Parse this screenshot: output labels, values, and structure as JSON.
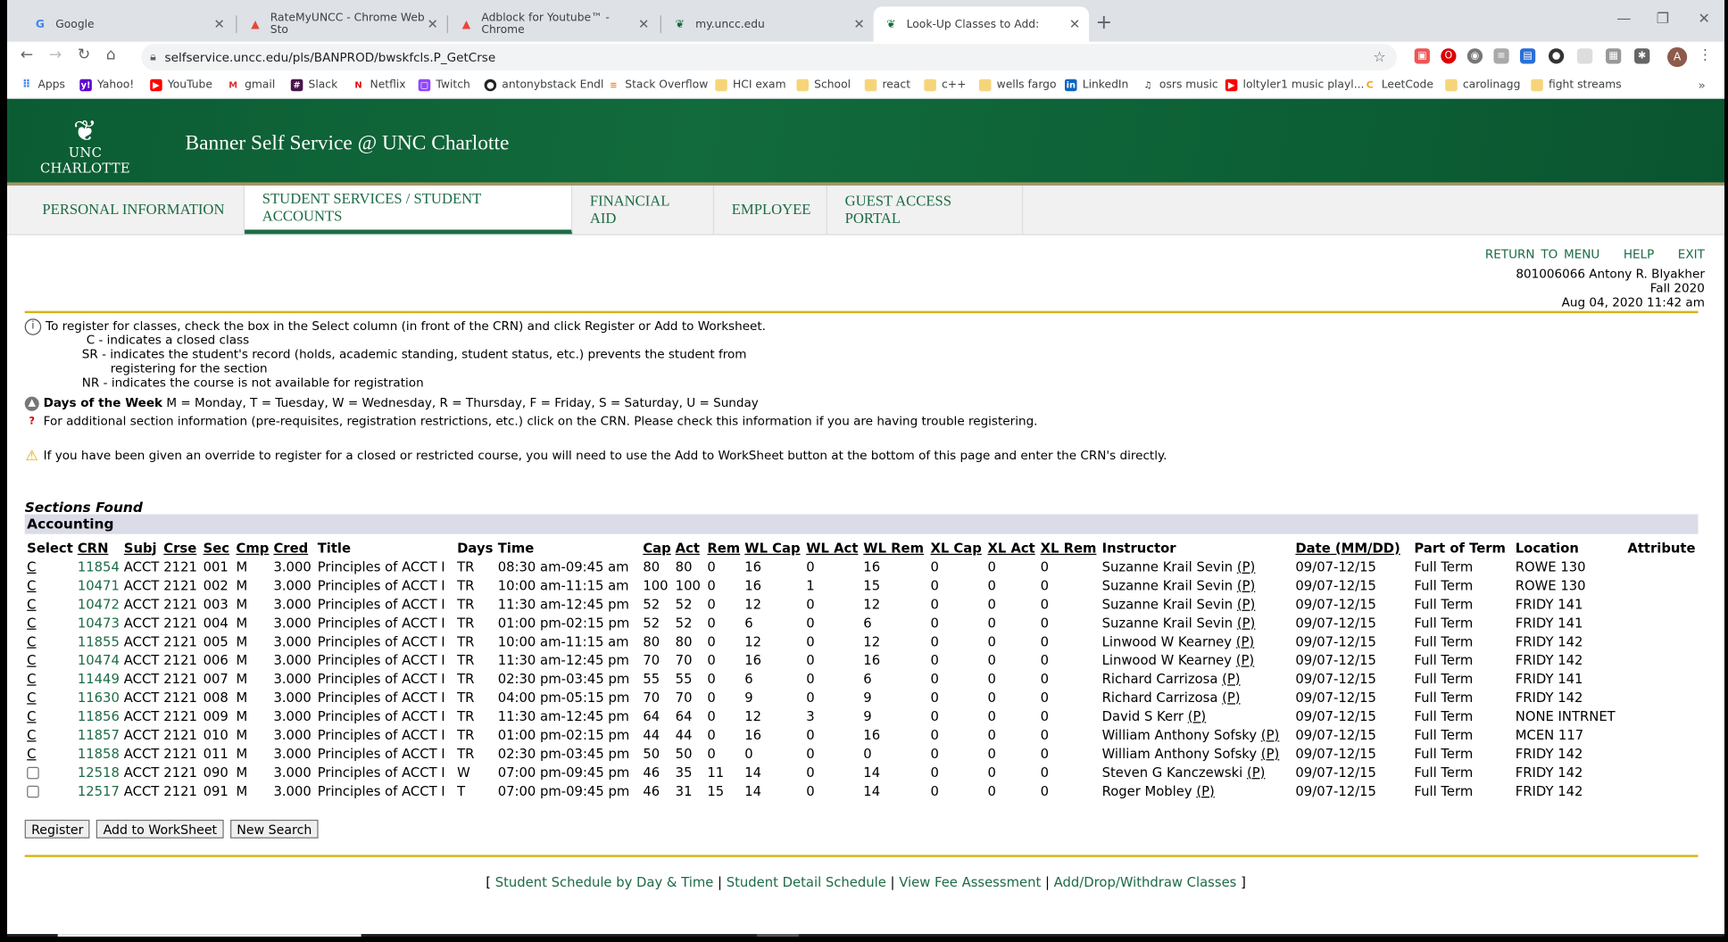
{
  "browser": {
    "tabs": [
      {
        "title": "Google",
        "favicon": "G"
      },
      {
        "title": "RateMyUNCC - Chrome Web Sto",
        "favicon": "▲"
      },
      {
        "title": "Adblock for Youtube™ - Chrome",
        "favicon": "▲"
      },
      {
        "title": "my.uncc.edu",
        "favicon": "❦"
      },
      {
        "title": "Look-Up Classes to Add:",
        "favicon": "❦"
      }
    ],
    "url": "selfservice.uncc.edu/pls/BANPROD/bwskfcls.P_GetCrse",
    "bookmarks": [
      "Apps",
      "Yahoo!",
      "YouTube",
      "gmail",
      "Slack",
      "Netflix",
      "Twitch",
      "antonybstack Endl",
      "Stack Overflow",
      "HCI exam",
      "School",
      "react",
      "c++",
      "wells fargo",
      "LinkedIn",
      "osrs music",
      "loltyler1 music playl...",
      "LeetCode",
      "carolinagg",
      "fight streams"
    ],
    "avatar_letter": "A"
  },
  "site": {
    "logo_text": "UNC CHARLOTTE",
    "title": "Banner Self Service @ UNC Charlotte",
    "nav": [
      "PERSONAL INFORMATION",
      "STUDENT SERVICES / STUDENT ACCOUNTS",
      "FINANCIAL AID",
      "EMPLOYEE",
      "GUEST ACCESS PORTAL"
    ],
    "toplinks": {
      "menu": "RETURN TO MENU",
      "help": "HELP",
      "exit": "EXIT"
    },
    "user": {
      "id_name": "801006066 Antony R. Blyakher",
      "term": "Fall 2020",
      "datetime": "Aug 04, 2020 11:42 am"
    }
  },
  "info": {
    "register": "To register for classes, check the box in the Select column (in front of the CRN) and click Register or Add to Worksheet.",
    "c_note": "C - indicates a closed class",
    "sr_note1": "SR - indicates the student's record (holds, academic standing, student status, etc.) prevents the student from",
    "sr_note2": "registering for the section",
    "nr_note": "NR - indicates the course is not available for registration",
    "days_label": "Days of the Week",
    "days_text": "M = Monday, T = Tuesday, W = Wednesday, R = Thursday, F = Friday, S = Saturday, U = Sunday",
    "additional": "For additional section information (pre-requisites, registration restrictions, etc.) click on the CRN. Please check this information if you are having trouble registering.",
    "override": "If you have been given an override to register for a closed or restricted course, you will need to use the Add to WorkSheet button at the bottom of this page and enter the CRN's directly."
  },
  "sections": {
    "heading": "Sections Found",
    "subject": "Accounting",
    "headers": [
      "Select",
      "CRN",
      "Subj",
      "Crse",
      "Sec",
      "Cmp",
      "Cred",
      "Title",
      "Days",
      "Time",
      "Cap",
      "Act",
      "Rem",
      "WL Cap",
      "WL Act",
      "WL Rem",
      "XL Cap",
      "XL Act",
      "XL Rem",
      "Instructor",
      "Date (MM/DD)",
      "Part of Term",
      "Location",
      "Attribute"
    ],
    "rows": [
      {
        "sel": "C",
        "crn": "11854",
        "subj": "ACCT",
        "crse": "2121",
        "sec": "001",
        "cmp": "M",
        "cred": "3.000",
        "title": "Principles of ACCT I",
        "days": "TR",
        "time": "08:30 am-09:45 am",
        "cap": "80",
        "act": "80",
        "rem": "0",
        "wlcap": "16",
        "wlact": "0",
        "wlrem": "16",
        "xlcap": "0",
        "xlact": "0",
        "xlrem": "0",
        "instr": "Suzanne Krail Sevin",
        "date": "09/07-12/15",
        "pot": "Full Term",
        "loc": "ROWE 130"
      },
      {
        "sel": "C",
        "crn": "10471",
        "subj": "ACCT",
        "crse": "2121",
        "sec": "002",
        "cmp": "M",
        "cred": "3.000",
        "title": "Principles of ACCT I",
        "days": "TR",
        "time": "10:00 am-11:15 am",
        "cap": "100",
        "act": "100",
        "rem": "0",
        "wlcap": "16",
        "wlact": "1",
        "wlrem": "15",
        "xlcap": "0",
        "xlact": "0",
        "xlrem": "0",
        "instr": "Suzanne Krail Sevin",
        "date": "09/07-12/15",
        "pot": "Full Term",
        "loc": "ROWE 130"
      },
      {
        "sel": "C",
        "crn": "10472",
        "subj": "ACCT",
        "crse": "2121",
        "sec": "003",
        "cmp": "M",
        "cred": "3.000",
        "title": "Principles of ACCT I",
        "days": "TR",
        "time": "11:30 am-12:45 pm",
        "cap": "52",
        "act": "52",
        "rem": "0",
        "wlcap": "12",
        "wlact": "0",
        "wlrem": "12",
        "xlcap": "0",
        "xlact": "0",
        "xlrem": "0",
        "instr": "Suzanne Krail Sevin",
        "date": "09/07-12/15",
        "pot": "Full Term",
        "loc": "FRIDY 141"
      },
      {
        "sel": "C",
        "crn": "10473",
        "subj": "ACCT",
        "crse": "2121",
        "sec": "004",
        "cmp": "M",
        "cred": "3.000",
        "title": "Principles of ACCT I",
        "days": "TR",
        "time": "01:00 pm-02:15 pm",
        "cap": "52",
        "act": "52",
        "rem": "0",
        "wlcap": "6",
        "wlact": "0",
        "wlrem": "6",
        "xlcap": "0",
        "xlact": "0",
        "xlrem": "0",
        "instr": "Suzanne Krail Sevin",
        "date": "09/07-12/15",
        "pot": "Full Term",
        "loc": "FRIDY 141"
      },
      {
        "sel": "C",
        "crn": "11855",
        "subj": "ACCT",
        "crse": "2121",
        "sec": "005",
        "cmp": "M",
        "cred": "3.000",
        "title": "Principles of ACCT I",
        "days": "TR",
        "time": "10:00 am-11:15 am",
        "cap": "80",
        "act": "80",
        "rem": "0",
        "wlcap": "12",
        "wlact": "0",
        "wlrem": "12",
        "xlcap": "0",
        "xlact": "0",
        "xlrem": "0",
        "instr": "Linwood W Kearney",
        "date": "09/07-12/15",
        "pot": "Full Term",
        "loc": "FRIDY 142"
      },
      {
        "sel": "C",
        "crn": "10474",
        "subj": "ACCT",
        "crse": "2121",
        "sec": "006",
        "cmp": "M",
        "cred": "3.000",
        "title": "Principles of ACCT I",
        "days": "TR",
        "time": "11:30 am-12:45 pm",
        "cap": "70",
        "act": "70",
        "rem": "0",
        "wlcap": "16",
        "wlact": "0",
        "wlrem": "16",
        "xlcap": "0",
        "xlact": "0",
        "xlrem": "0",
        "instr": "Linwood W Kearney",
        "date": "09/07-12/15",
        "pot": "Full Term",
        "loc": "FRIDY 142"
      },
      {
        "sel": "C",
        "crn": "11449",
        "subj": "ACCT",
        "crse": "2121",
        "sec": "007",
        "cmp": "M",
        "cred": "3.000",
        "title": "Principles of ACCT I",
        "days": "TR",
        "time": "02:30 pm-03:45 pm",
        "cap": "55",
        "act": "55",
        "rem": "0",
        "wlcap": "6",
        "wlact": "0",
        "wlrem": "6",
        "xlcap": "0",
        "xlact": "0",
        "xlrem": "0",
        "instr": "Richard Carrizosa",
        "date": "09/07-12/15",
        "pot": "Full Term",
        "loc": "FRIDY 141"
      },
      {
        "sel": "C",
        "crn": "11630",
        "subj": "ACCT",
        "crse": "2121",
        "sec": "008",
        "cmp": "M",
        "cred": "3.000",
        "title": "Principles of ACCT I",
        "days": "TR",
        "time": "04:00 pm-05:15 pm",
        "cap": "70",
        "act": "70",
        "rem": "0",
        "wlcap": "9",
        "wlact": "0",
        "wlrem": "9",
        "xlcap": "0",
        "xlact": "0",
        "xlrem": "0",
        "instr": "Richard Carrizosa",
        "date": "09/07-12/15",
        "pot": "Full Term",
        "loc": "FRIDY 142"
      },
      {
        "sel": "C",
        "crn": "11856",
        "subj": "ACCT",
        "crse": "2121",
        "sec": "009",
        "cmp": "M",
        "cred": "3.000",
        "title": "Principles of ACCT I",
        "days": "TR",
        "time": "11:30 am-12:45 pm",
        "cap": "64",
        "act": "64",
        "rem": "0",
        "wlcap": "12",
        "wlact": "3",
        "wlrem": "9",
        "xlcap": "0",
        "xlact": "0",
        "xlrem": "0",
        "instr": "David S Kerr",
        "date": "09/07-12/15",
        "pot": "Full Term",
        "loc": "NONE INTRNET"
      },
      {
        "sel": "C",
        "crn": "11857",
        "subj": "ACCT",
        "crse": "2121",
        "sec": "010",
        "cmp": "M",
        "cred": "3.000",
        "title": "Principles of ACCT I",
        "days": "TR",
        "time": "01:00 pm-02:15 pm",
        "cap": "44",
        "act": "44",
        "rem": "0",
        "wlcap": "16",
        "wlact": "0",
        "wlrem": "16",
        "xlcap": "0",
        "xlact": "0",
        "xlrem": "0",
        "instr": "William Anthony Sofsky",
        "date": "09/07-12/15",
        "pot": "Full Term",
        "loc": "MCEN 117"
      },
      {
        "sel": "C",
        "crn": "11858",
        "subj": "ACCT",
        "crse": "2121",
        "sec": "011",
        "cmp": "M",
        "cred": "3.000",
        "title": "Principles of ACCT I",
        "days": "TR",
        "time": "02:30 pm-03:45 pm",
        "cap": "50",
        "act": "50",
        "rem": "0",
        "wlcap": "0",
        "wlact": "0",
        "wlrem": "0",
        "xlcap": "0",
        "xlact": "0",
        "xlrem": "0",
        "instr": "William Anthony Sofsky",
        "date": "09/07-12/15",
        "pot": "Full Term",
        "loc": "FRIDY 142"
      },
      {
        "sel": "",
        "crn": "12518",
        "subj": "ACCT",
        "crse": "2121",
        "sec": "090",
        "cmp": "M",
        "cred": "3.000",
        "title": "Principles of ACCT I",
        "days": "W",
        "time": "07:00 pm-09:45 pm",
        "cap": "46",
        "act": "35",
        "rem": "11",
        "wlcap": "14",
        "wlact": "0",
        "wlrem": "14",
        "xlcap": "0",
        "xlact": "0",
        "xlrem": "0",
        "instr": "Steven G Kanczewski",
        "date": "09/07-12/15",
        "pot": "Full Term",
        "loc": "FRIDY 142"
      },
      {
        "sel": "",
        "crn": "12517",
        "subj": "ACCT",
        "crse": "2121",
        "sec": "091",
        "cmp": "M",
        "cred": "3.000",
        "title": "Principles of ACCT I",
        "days": "T",
        "time": "07:00 pm-09:45 pm",
        "cap": "46",
        "act": "31",
        "rem": "15",
        "wlcap": "14",
        "wlact": "0",
        "wlrem": "14",
        "xlcap": "0",
        "xlact": "0",
        "xlrem": "0",
        "instr": "Roger Mobley",
        "date": "09/07-12/15",
        "pot": "Full Term",
        "loc": "FRIDY 142"
      }
    ],
    "primary_marker": "(P)"
  },
  "buttons": {
    "register": "Register",
    "worksheet": "Add to WorkSheet",
    "search": "New Search"
  },
  "footer": {
    "l1": "Student Schedule by Day & Time",
    "l2": "Student Detail Schedule",
    "l3": "View Fee Assessment",
    "l4": "Add/Drop/Withdraw Classes",
    "open": "[",
    "close": "]",
    "sep": "|"
  },
  "colors": {
    "brand_green": "#126b3c",
    "link_green": "#1d6b45",
    "gold": "#d4b31c"
  }
}
